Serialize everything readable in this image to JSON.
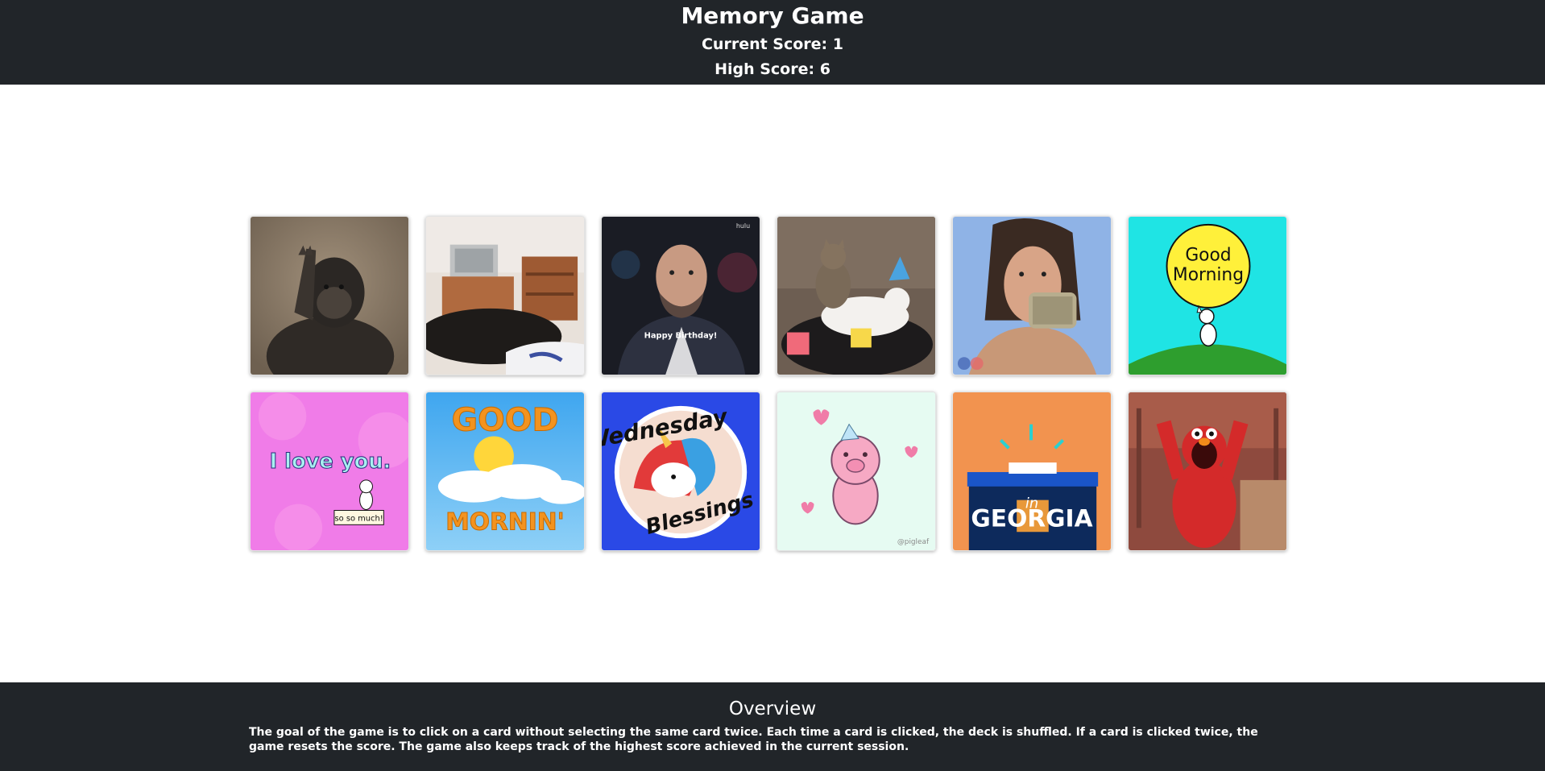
{
  "header": {
    "title": "Memory Game",
    "current_score": "Current Score: 1",
    "high_score": "High Score: 6"
  },
  "cards": [
    {
      "name": "card-gorilla-clapping"
    },
    {
      "name": "card-cat-in-room"
    },
    {
      "name": "card-happy-birthday-man",
      "caption": "Happy Birthday!",
      "corner_logo": "hulu"
    },
    {
      "name": "card-cats-with-party-hat"
    },
    {
      "name": "card-woman-with-money"
    },
    {
      "name": "card-good-morning-dog",
      "caption_line1": "Good",
      "caption_line2": "Morning"
    },
    {
      "name": "card-i-love-you-dog",
      "caption": "I love you.",
      "sign": "so so much!"
    },
    {
      "name": "card-good-mornin-sun",
      "caption_top": "GOOD",
      "caption_bottom": "MORNIN'"
    },
    {
      "name": "card-wednesday-blessings-unicorn",
      "caption_top": "Wednesday",
      "caption_bottom": "Blessings"
    },
    {
      "name": "card-pig-dancing",
      "watermark": "@pigleaf"
    },
    {
      "name": "card-georgia-ballot-box",
      "caption": "GEORGIA",
      "overlay": "in"
    },
    {
      "name": "card-elmo-celebrating"
    }
  ],
  "footer": {
    "title": "Overview",
    "text": "The goal of the game is to click on a card without selecting the same card twice. Each time a card is clicked, the deck is shuffled. If a card is clicked twice, the game resets the score. The game also keeps track of the highest score achieved in the current session."
  },
  "colors": {
    "header_bg": "#212529",
    "footer_bg": "#212529",
    "text_light": "#ffffff"
  }
}
